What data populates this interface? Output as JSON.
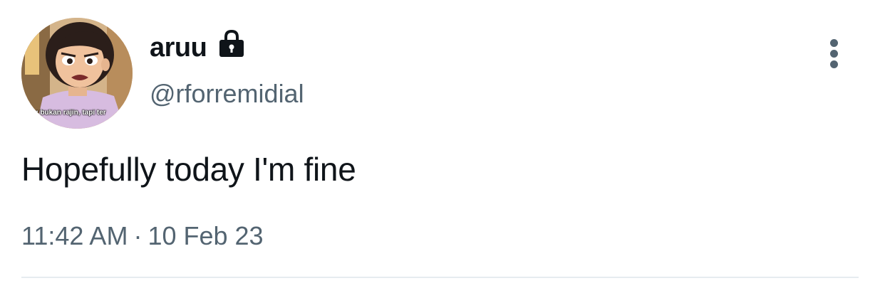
{
  "tweet": {
    "author": {
      "display_name": "aruu",
      "handle": "@rforremidial",
      "protected_icon": "lock-icon",
      "avatar_caption": "ku bukan rajin, tapi ter"
    },
    "text": "Hopefully today I'm fine",
    "time": "11:42 AM",
    "separator": "·",
    "date": "10 Feb 23",
    "more_icon": "more-vertical-icon"
  },
  "colors": {
    "primary_text": "#0f1419",
    "secondary_text": "#536471",
    "divider": "#e6ecf0",
    "background": "#ffffff"
  }
}
